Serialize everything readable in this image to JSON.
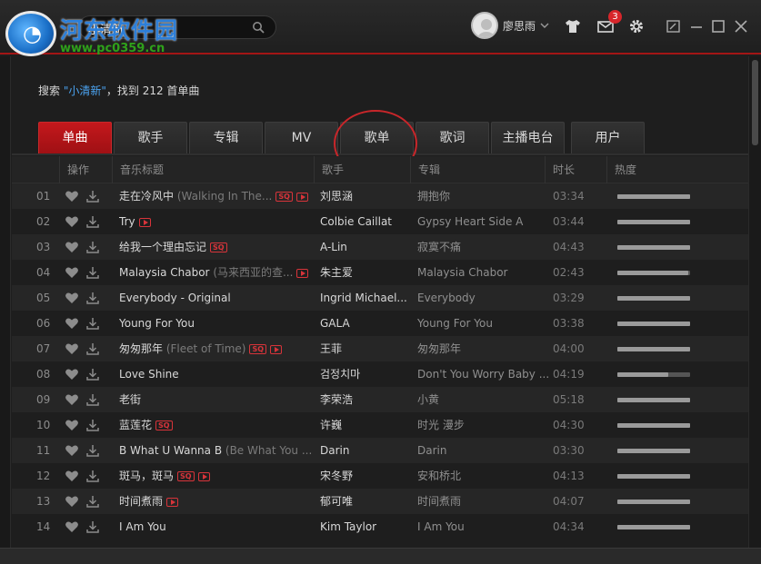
{
  "header": {
    "watermark": "河东软件园",
    "watermark_url": "www.pc0359.cn",
    "search_value": "小清新",
    "username": "廖思雨",
    "notification_count": "3",
    "icons": [
      "search-icon",
      "tshirt-icon",
      "mail-icon",
      "gear-icon",
      "mini-mode-icon",
      "minimize-icon",
      "maximize-icon",
      "close-icon"
    ]
  },
  "summary": {
    "prefix": "搜索 ",
    "keyword": "\"小清新\"",
    "suffix": "，找到 212 首单曲"
  },
  "tabs": [
    {
      "label": "单曲",
      "active": true
    },
    {
      "label": "歌手",
      "active": false
    },
    {
      "label": "专辑",
      "active": false
    },
    {
      "label": "MV",
      "active": false
    },
    {
      "label": "歌单",
      "active": false
    },
    {
      "label": "歌词",
      "active": false
    },
    {
      "label": "主播电台",
      "active": false
    },
    {
      "label": "用户",
      "active": false
    }
  ],
  "columns": {
    "ops": "操作",
    "title": "音乐标题",
    "artist": "歌手",
    "album": "专辑",
    "duration": "时长",
    "heat": "热度"
  },
  "tracks": [
    {
      "num": "01",
      "title": "走在冷风中",
      "sub": "(Walking In The...",
      "sq": true,
      "mv": true,
      "artist": "刘思涵",
      "album": "拥抱你",
      "duration": "03:34",
      "heat": 1.0
    },
    {
      "num": "02",
      "title": "Try",
      "sub": "",
      "sq": false,
      "mv": true,
      "artist": "Colbie Caillat",
      "album": "Gypsy Heart Side A",
      "duration": "03:44",
      "heat": 1.0
    },
    {
      "num": "03",
      "title": "给我一个理由忘记",
      "sub": "",
      "sq": true,
      "mv": false,
      "artist": "A-Lin",
      "album": "寂寞不痛",
      "duration": "04:43",
      "heat": 1.0
    },
    {
      "num": "04",
      "title": "Malaysia Chabor",
      "sub": "(马来西亚的查...",
      "sq": false,
      "mv": true,
      "artist": "朱主爱",
      "album": "Malaysia Chabor",
      "duration": "02:43",
      "heat": 0.98
    },
    {
      "num": "05",
      "title": "Everybody - Original",
      "sub": "",
      "sq": false,
      "mv": false,
      "artist": "Ingrid Michael...",
      "album": "Everybody",
      "duration": "03:29",
      "heat": 1.0
    },
    {
      "num": "06",
      "title": "Young For You",
      "sub": "",
      "sq": false,
      "mv": false,
      "artist": "GALA",
      "album": "Young For You",
      "duration": "03:38",
      "heat": 1.0
    },
    {
      "num": "07",
      "title": "匆匆那年",
      "sub": "(Fleet of Time)",
      "sq": true,
      "mv": true,
      "artist": "王菲",
      "album": "匆匆那年",
      "duration": "04:00",
      "heat": 1.0
    },
    {
      "num": "08",
      "title": "Love Shine",
      "sub": "",
      "sq": false,
      "mv": false,
      "artist": "검정치마",
      "album": "Don't You Worry Baby ...",
      "duration": "04:19",
      "heat": 0.7
    },
    {
      "num": "09",
      "title": "老街",
      "sub": "",
      "sq": false,
      "mv": false,
      "artist": "李荣浩",
      "album": "小黄",
      "duration": "05:18",
      "heat": 1.0
    },
    {
      "num": "10",
      "title": "蓝莲花",
      "sub": "",
      "sq": true,
      "mv": false,
      "artist": "许巍",
      "album": "时光 漫步",
      "duration": "04:30",
      "heat": 1.0
    },
    {
      "num": "11",
      "title": "B What U Wanna B",
      "sub": "(Be What You ...",
      "sq": false,
      "mv": false,
      "artist": "Darin",
      "album": "Darin",
      "duration": "03:30",
      "heat": 1.0
    },
    {
      "num": "12",
      "title": "斑马，斑马",
      "sub": "",
      "sq": true,
      "mv": true,
      "artist": "宋冬野",
      "album": "安和桥北",
      "duration": "04:13",
      "heat": 1.0
    },
    {
      "num": "13",
      "title": "时间煮雨",
      "sub": "",
      "sq": false,
      "mv": true,
      "artist": "郁可唯",
      "album": "时间煮雨",
      "duration": "04:07",
      "heat": 1.0
    },
    {
      "num": "14",
      "title": "I Am You",
      "sub": "",
      "sq": false,
      "mv": false,
      "artist": "Kim Taylor",
      "album": "I Am You",
      "duration": "04:34",
      "heat": 1.0
    }
  ]
}
